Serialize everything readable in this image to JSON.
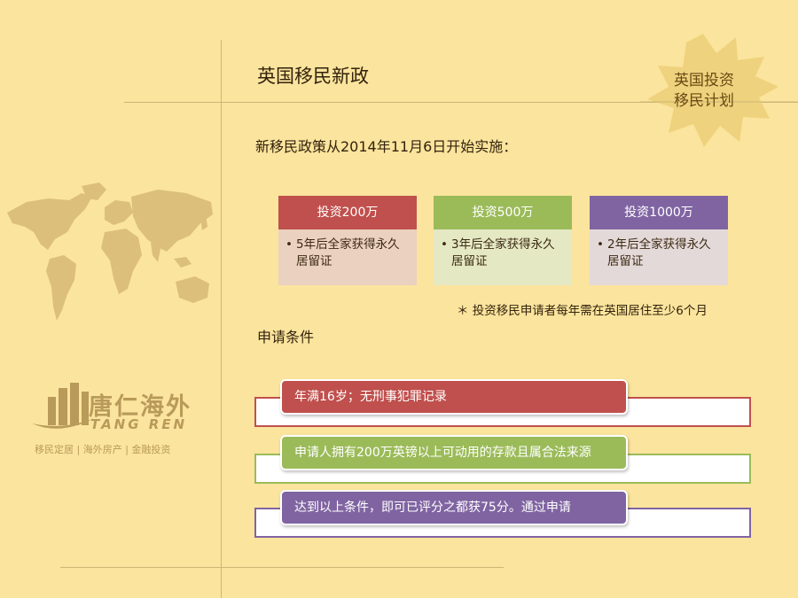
{
  "title": "英国移民新政",
  "intro": "新移民政策从2014年11月6日开始实施：",
  "badge": {
    "line1": "英国投资",
    "line2": "移民计划"
  },
  "investment_cards": [
    {
      "header": "投资200万",
      "body": "5年后全家获得永久居留证",
      "color": "#c0504d"
    },
    {
      "header": "投资500万",
      "body": "3年后全家获得永久居留证",
      "color": "#9bbb59"
    },
    {
      "header": "投资1000万",
      "body": "2年后全家获得永久居留证",
      "color": "#8064a2"
    }
  ],
  "bullet": "•",
  "footnote": "＊ 投资移民申请者每年需在英国居住至少6个月",
  "conditions_heading": "申请条件",
  "conditions": [
    {
      "text": "年满16岁；无刑事犯罪记录",
      "color": "#c0504d"
    },
    {
      "text": "申请人拥有200万英镑以上可动用的存款且属合法来源",
      "color": "#9bbb59"
    },
    {
      "text": "达到以上条件，即可已评分之都获75分。通过申请",
      "color": "#8064a2"
    }
  ],
  "logo": {
    "name_cn": "唐仁海外",
    "name_en": "TANG REN",
    "tagline": "移民定居 | 海外房产 | 金融投资"
  },
  "colors": {
    "background": "#fbe49d",
    "accent": "#cdb577",
    "logo": "#b89a5a"
  }
}
